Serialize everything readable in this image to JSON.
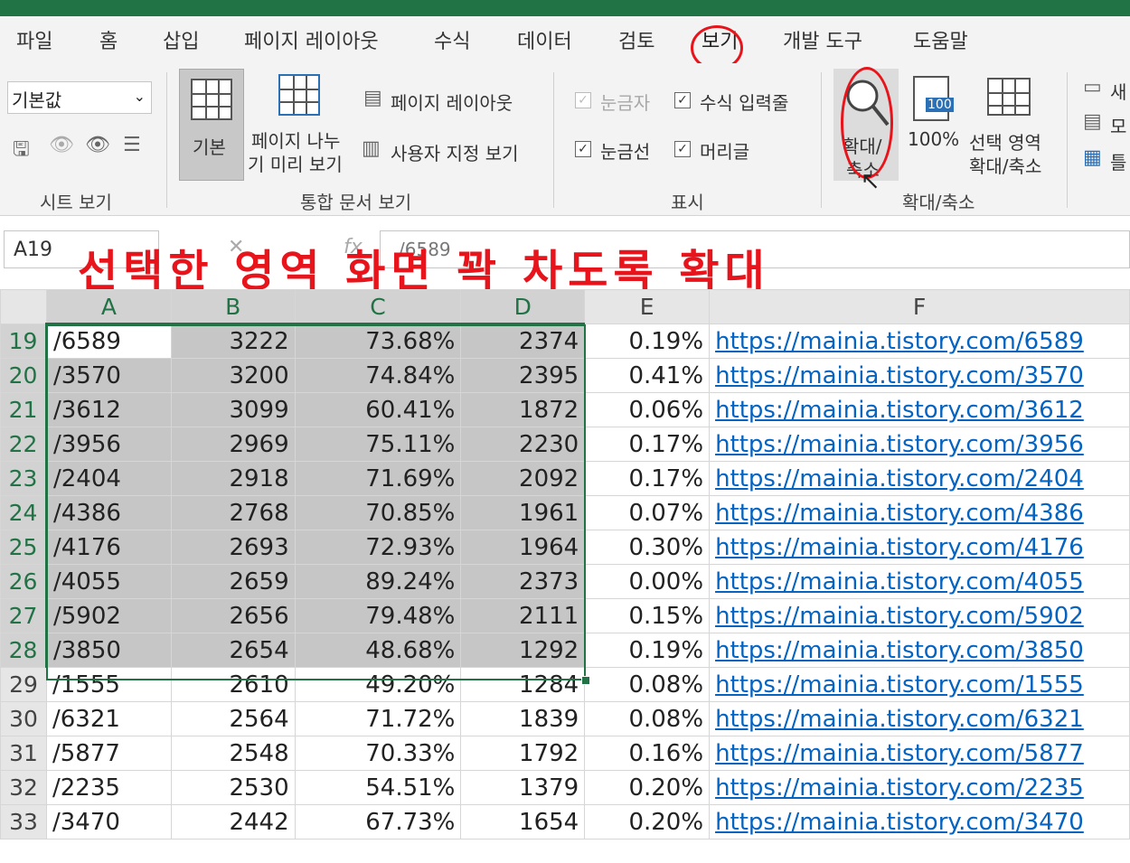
{
  "menu": [
    "파일",
    "홈",
    "삽입",
    "페이지 레이아웃",
    "수식",
    "데이터",
    "검토",
    "보기",
    "개발 도구",
    "도움말"
  ],
  "ribbon": {
    "sheet_view": {
      "dropdown_value": "기본값",
      "group_label": "시트 보기"
    },
    "workbook_views": {
      "normal": "기본",
      "page_break_1": "페이지 나누",
      "page_break_2": "기 미리 보기",
      "page_layout": "페이지 레이아웃",
      "custom_views": "사용자 지정 보기",
      "group_label": "통합 문서 보기"
    },
    "show": {
      "ruler": "눈금자",
      "formula_bar": "수식 입력줄",
      "gridlines": "눈금선",
      "headings": "머리글",
      "group_label": "표시"
    },
    "zoom": {
      "zoom_1": "확대/",
      "zoom_2": "축소",
      "hundred": "100%",
      "icon_100": "100",
      "selection_1": "선택 영역",
      "selection_2": "확대/축소",
      "group_label": "확대/축소"
    },
    "window": {
      "new": "새",
      "arrange": "모",
      "freeze": "틀"
    }
  },
  "formula_bar": {
    "name_box": "A19",
    "content": "/6589"
  },
  "annotation": "선택한 영역 화면 꽉 차도록 확대",
  "sheet": {
    "columns": [
      "A",
      "B",
      "C",
      "D",
      "E",
      "F"
    ],
    "rows": [
      {
        "n": "19",
        "a": "/6589",
        "b": "3222",
        "c": "73.68%",
        "d": "2374",
        "e": "0.19%",
        "f": "https://mainia.tistory.com/6589"
      },
      {
        "n": "20",
        "a": "/3570",
        "b": "3200",
        "c": "74.84%",
        "d": "2395",
        "e": "0.41%",
        "f": "https://mainia.tistory.com/3570"
      },
      {
        "n": "21",
        "a": "/3612",
        "b": "3099",
        "c": "60.41%",
        "d": "1872",
        "e": "0.06%",
        "f": "https://mainia.tistory.com/3612"
      },
      {
        "n": "22",
        "a": "/3956",
        "b": "2969",
        "c": "75.11%",
        "d": "2230",
        "e": "0.17%",
        "f": "https://mainia.tistory.com/3956"
      },
      {
        "n": "23",
        "a": "/2404",
        "b": "2918",
        "c": "71.69%",
        "d": "2092",
        "e": "0.17%",
        "f": "https://mainia.tistory.com/2404"
      },
      {
        "n": "24",
        "a": "/4386",
        "b": "2768",
        "c": "70.85%",
        "d": "1961",
        "e": "0.07%",
        "f": "https://mainia.tistory.com/4386"
      },
      {
        "n": "25",
        "a": "/4176",
        "b": "2693",
        "c": "72.93%",
        "d": "1964",
        "e": "0.30%",
        "f": "https://mainia.tistory.com/4176"
      },
      {
        "n": "26",
        "a": "/4055",
        "b": "2659",
        "c": "89.24%",
        "d": "2373",
        "e": "0.00%",
        "f": "https://mainia.tistory.com/4055"
      },
      {
        "n": "27",
        "a": "/5902",
        "b": "2656",
        "c": "79.48%",
        "d": "2111",
        "e": "0.15%",
        "f": "https://mainia.tistory.com/5902"
      },
      {
        "n": "28",
        "a": "/3850",
        "b": "2654",
        "c": "48.68%",
        "d": "1292",
        "e": "0.19%",
        "f": "https://mainia.tistory.com/3850"
      },
      {
        "n": "29",
        "a": "/1555",
        "b": "2610",
        "c": "49.20%",
        "d": "1284",
        "e": "0.08%",
        "f": "https://mainia.tistory.com/1555"
      },
      {
        "n": "30",
        "a": "/6321",
        "b": "2564",
        "c": "71.72%",
        "d": "1839",
        "e": "0.08%",
        "f": "https://mainia.tistory.com/6321"
      },
      {
        "n": "31",
        "a": "/5877",
        "b": "2548",
        "c": "70.33%",
        "d": "1792",
        "e": "0.16%",
        "f": "https://mainia.tistory.com/5877"
      },
      {
        "n": "32",
        "a": "/2235",
        "b": "2530",
        "c": "54.51%",
        "d": "1379",
        "e": "0.20%",
        "f": "https://mainia.tistory.com/2235"
      },
      {
        "n": "33",
        "a": "/3470",
        "b": "2442",
        "c": "67.73%",
        "d": "1654",
        "e": "0.20%",
        "f": "https://mainia.tistory.com/3470"
      }
    ]
  },
  "colors": {
    "accent": "#217346",
    "annotation": "#e8141b",
    "link": "#0563c1",
    "selection_fill": "#c6c6c6"
  }
}
